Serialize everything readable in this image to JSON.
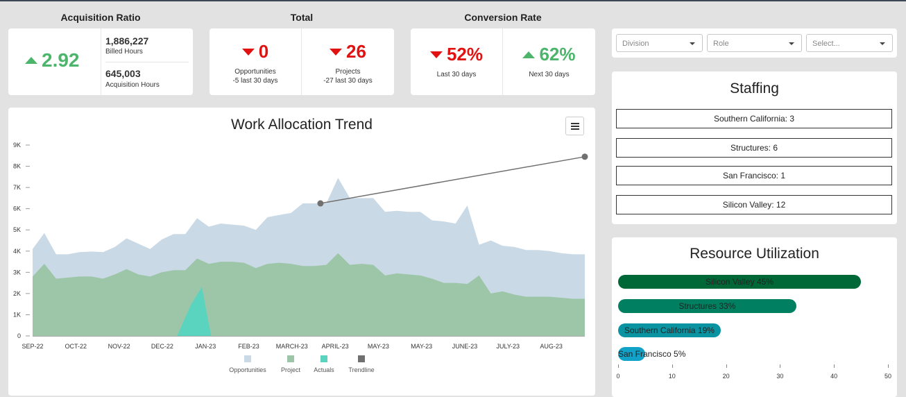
{
  "kpis": {
    "acquisition": {
      "title": "Acquisition Ratio",
      "ratio": "2.92",
      "billed_value": "1,886,227",
      "billed_label": "Billed Hours",
      "acq_value": "645,003",
      "acq_label": "Acquisition Hours"
    },
    "total": {
      "title": "Total",
      "opportunities_value": "0",
      "opportunities_label": "Opportunities",
      "opportunities_sub": "-5 last 30 days",
      "projects_value": "26",
      "projects_label": "Projects",
      "projects_sub": "-27 last 30 days"
    },
    "conversion": {
      "title": "Conversion Rate",
      "last_value": "52%",
      "last_label": "Last 30 days",
      "next_value": "62%",
      "next_label": "Next 30 days"
    }
  },
  "filters": {
    "division_placeholder": "Division",
    "role_placeholder": "Role",
    "select_placeholder": "Select..."
  },
  "staffing": {
    "title": "Staffing",
    "items": [
      "Southern California: 3",
      "Structures: 6",
      "San Francisco: 1",
      "Silicon Valley: 12"
    ]
  },
  "utilization": {
    "title": "Resource Utilization",
    "items": [
      {
        "label": "Silicon Valley 45%",
        "value": 45,
        "color": "#006837"
      },
      {
        "label": "Structures 33%",
        "value": 33,
        "color": "#008060"
      },
      {
        "label": "Southern California 19%",
        "value": 19,
        "color": "#0a93a0"
      },
      {
        "label": "San Francisco 5%",
        "value": 5,
        "color": "#12a2c8"
      }
    ],
    "ticks": [
      "0",
      "10",
      "20",
      "30",
      "40",
      "50"
    ],
    "max": 50
  },
  "chart_data": {
    "type": "area",
    "title": "Work Allocation Trend",
    "y_ticks": [
      "0",
      "1K",
      "2K",
      "3K",
      "4K",
      "5K",
      "6K",
      "7K",
      "8K",
      "9K"
    ],
    "ylim": [
      0,
      9000
    ],
    "x_ticks": [
      "SEP-22",
      "OCT-22",
      "NOV-22",
      "DEC-22",
      "JAN-23",
      "FEB-23",
      "MARCH-23",
      "APRIL-23",
      "MAY-23",
      "MAY-23",
      "JUNE-23",
      "JULY-23",
      "AUG-23"
    ],
    "series": [
      {
        "name": "Opportunities",
        "color": "#c9d9e5",
        "values": [
          4100,
          4850,
          3850,
          3850,
          3950,
          3980,
          3950,
          4200,
          4600,
          4350,
          4100,
          4550,
          4800,
          4800,
          5550,
          5150,
          5300,
          5250,
          5200,
          5000,
          5600,
          5700,
          5800,
          6250,
          6250,
          6250,
          7450,
          6500,
          6500,
          6500,
          5850,
          5900,
          5850,
          5850,
          5450,
          5400,
          5300,
          6150,
          4300,
          4500,
          4250,
          4200,
          4050,
          4050,
          4000,
          3900,
          3850,
          3850
        ]
      },
      {
        "name": "Project",
        "color": "#9dc6a9",
        "values": [
          2800,
          3400,
          2700,
          2750,
          2800,
          2800,
          2700,
          2900,
          3150,
          2900,
          2800,
          3000,
          3100,
          3100,
          3650,
          3400,
          3500,
          3500,
          3450,
          3200,
          3400,
          3450,
          3400,
          3300,
          3300,
          3350,
          3900,
          3350,
          3400,
          3350,
          2850,
          2950,
          2900,
          2850,
          2700,
          2500,
          2500,
          2450,
          2850,
          2000,
          2100,
          1950,
          1850,
          1850,
          1850,
          1800,
          1750,
          1750
        ]
      },
      {
        "name": "Actuals",
        "color": "#5ad3bf",
        "points": [
          [
            12.3,
            0
          ],
          [
            13.5,
            1500
          ],
          [
            14.4,
            2300
          ],
          [
            15.2,
            0
          ]
        ]
      },
      {
        "name": "Trendline",
        "color": "#707070",
        "points": [
          [
            24.5,
            6250
          ],
          [
            47,
            8450
          ]
        ]
      }
    ]
  }
}
